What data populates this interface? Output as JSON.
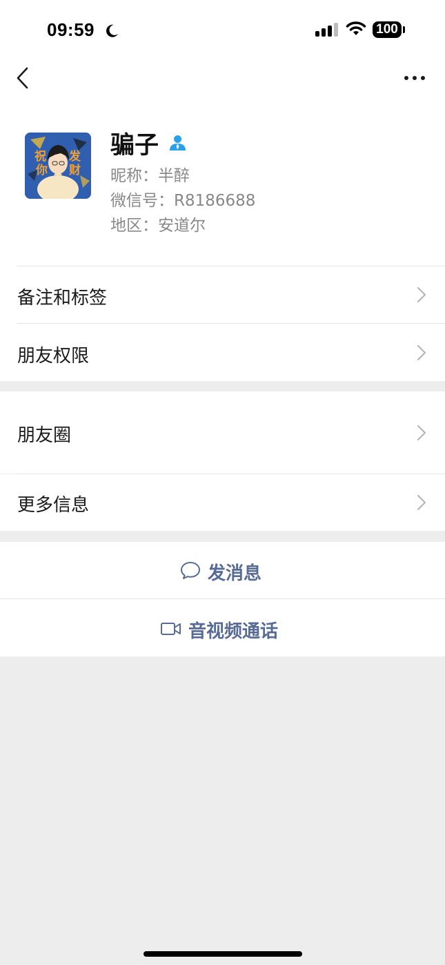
{
  "status_bar": {
    "time": "09:59",
    "battery": "100"
  },
  "profile": {
    "name": "骗子",
    "nickname": "昵称：半醉",
    "wechat_id": "微信号：R8186688",
    "region": "地区：安道尔",
    "avatar_text": [
      "祝",
      "你",
      "发",
      "财"
    ]
  },
  "rows": {
    "remarks": "备注和标签",
    "permissions": "朋友权限",
    "moments": "朋友圈",
    "more_info": "更多信息"
  },
  "actions": {
    "message": "发消息",
    "call": "音视频通话"
  },
  "colors": {
    "link": "#576b95",
    "verified": "#2aa0e8",
    "background": "#ededed"
  }
}
